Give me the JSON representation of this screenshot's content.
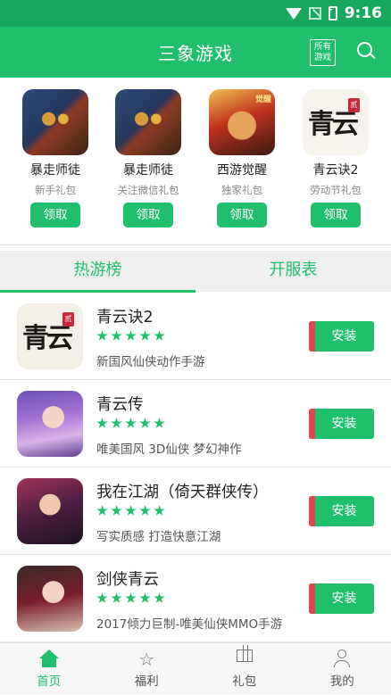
{
  "status_bar": {
    "time": "9:16"
  },
  "header": {
    "title": "三象游戏",
    "all_games_label": "所有\n游戏"
  },
  "gifts": [
    {
      "name": "暴走师徒",
      "subtitle": "新手礼包",
      "button": "领取",
      "icon": "monkey-king-icon"
    },
    {
      "name": "暴走师徒",
      "subtitle": "关注微信礼包",
      "button": "领取",
      "icon": "monkey-king-icon"
    },
    {
      "name": "西游觉醒",
      "subtitle": "独家礼包",
      "button": "领取",
      "icon": "wukong-icon",
      "icon_tag": "觉醒"
    },
    {
      "name": "青云诀2",
      "subtitle": "劳动节礼包",
      "button": "领取",
      "icon": "qingyun-calligraphy-icon",
      "icon_text": "青云",
      "icon_seal": "贰"
    }
  ],
  "tabs": [
    {
      "label": "热游榜",
      "active": true
    },
    {
      "label": "开服表",
      "active": false
    }
  ],
  "games": [
    {
      "name": "青云诀2",
      "rating": 5,
      "description": "新国风仙侠动作手游",
      "button": "安装",
      "icon": "qingyun-calligraphy-icon",
      "icon_text": "青云",
      "icon_seal": "贰"
    },
    {
      "name": "青云传",
      "rating": 5,
      "description": "唯美国风 3D仙侠 梦幻神作",
      "button": "安装",
      "icon": "fairy-character-icon"
    },
    {
      "name": "我在江湖（倚天群侠传）",
      "rating": 5,
      "description": "写实质感 打造快意江湖",
      "button": "安装",
      "icon": "swordswoman-icon"
    },
    {
      "name": "剑侠青云",
      "rating": 5,
      "description": "2017倾力巨制-唯美仙侠MMO手游",
      "button": "安装",
      "icon": "swordswoman-red-icon"
    }
  ],
  "bottom_nav": [
    {
      "label": "首页",
      "icon": "home-icon",
      "active": true
    },
    {
      "label": "福利",
      "icon": "star-icon",
      "active": false
    },
    {
      "label": "礼包",
      "icon": "gift-icon",
      "active": false
    },
    {
      "label": "我的",
      "icon": "user-icon",
      "active": false
    }
  ],
  "colors": {
    "primary": "#1fbf6c",
    "status_bar": "#17a85c",
    "install_accent": "#e0444e"
  }
}
